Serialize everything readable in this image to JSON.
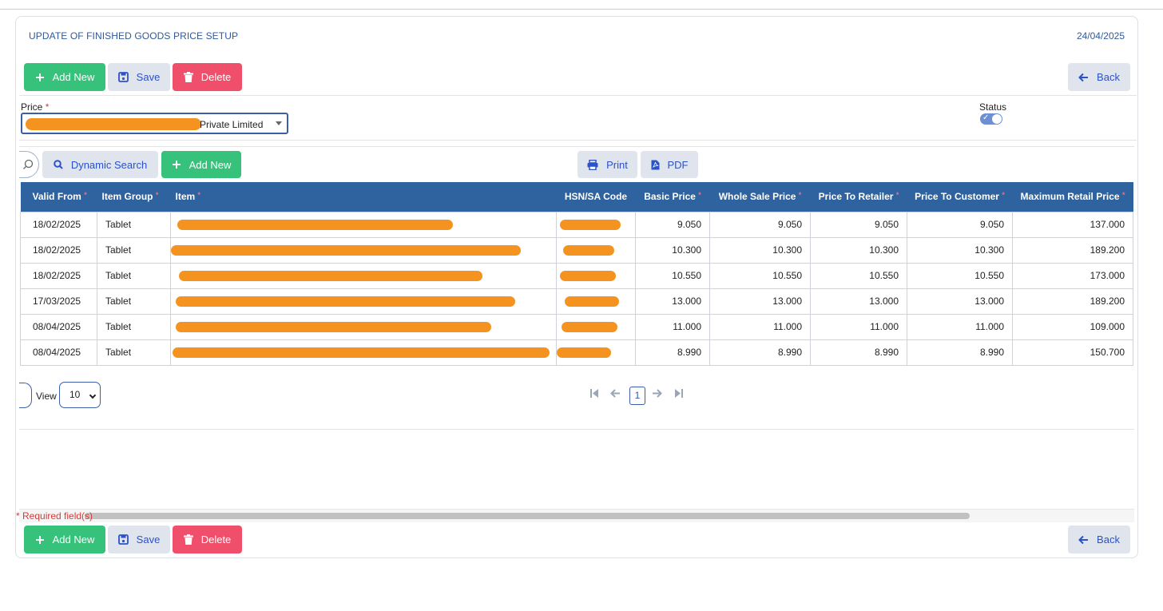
{
  "page": {
    "title": "UPDATE OF FINISHED GOODS PRICE SETUP",
    "date": "24/04/2025"
  },
  "toolbar": {
    "add_new": "Add New",
    "save": "Save",
    "delete": "Delete",
    "back": "Back"
  },
  "form": {
    "price_label": "Price",
    "required_mark": "*",
    "price_value": "Private Limited",
    "status_label": "Status",
    "status_on": true
  },
  "grid": {
    "dynamic_search": "Dynamic Search",
    "add_new": "Add New",
    "print": "Print",
    "pdf": "PDF",
    "columns": [
      {
        "label": "Valid From",
        "required": true
      },
      {
        "label": "Item Group",
        "required": true
      },
      {
        "label": "Item",
        "required": true
      },
      {
        "label": "HSN/SA Code",
        "required": false
      },
      {
        "label": "Basic Price",
        "required": true
      },
      {
        "label": "Whole Sale Price",
        "required": true
      },
      {
        "label": "Price To Retailer",
        "required": true
      },
      {
        "label": "Price To Customer",
        "required": true
      },
      {
        "label": "Maximum Retail Price",
        "required": true
      }
    ],
    "rows": [
      {
        "valid_from": "18/02/2025",
        "item_group": "Tablet",
        "basic": "9.050",
        "wholesale": "9.050",
        "retailer": "9.050",
        "customer": "9.050",
        "mrp": "137.000"
      },
      {
        "valid_from": "18/02/2025",
        "item_group": "Tablet",
        "basic": "10.300",
        "wholesale": "10.300",
        "retailer": "10.300",
        "customer": "10.300",
        "mrp": "189.200"
      },
      {
        "valid_from": "18/02/2025",
        "item_group": "Tablet",
        "basic": "10.550",
        "wholesale": "10.550",
        "retailer": "10.550",
        "customer": "10.550",
        "mrp": "173.000"
      },
      {
        "valid_from": "17/03/2025",
        "item_group": "Tablet",
        "basic": "13.000",
        "wholesale": "13.000",
        "retailer": "13.000",
        "customer": "13.000",
        "mrp": "189.200"
      },
      {
        "valid_from": "08/04/2025",
        "item_group": "Tablet",
        "basic": "11.000",
        "wholesale": "11.000",
        "retailer": "11.000",
        "customer": "11.000",
        "mrp": "109.000"
      },
      {
        "valid_from": "08/04/2025",
        "item_group": "Tablet",
        "basic": "8.990",
        "wholesale": "8.990",
        "retailer": "8.990",
        "customer": "8.990",
        "mrp": "150.700"
      }
    ],
    "view_label": "View",
    "page_size": "10",
    "current_page": "1"
  },
  "footer": {
    "required_note": "* Required field(s)"
  },
  "colors": {
    "accent": "#2f63a0",
    "green": "#36c27a",
    "red": "#ef4f6b",
    "redaction": "#f4931f"
  }
}
